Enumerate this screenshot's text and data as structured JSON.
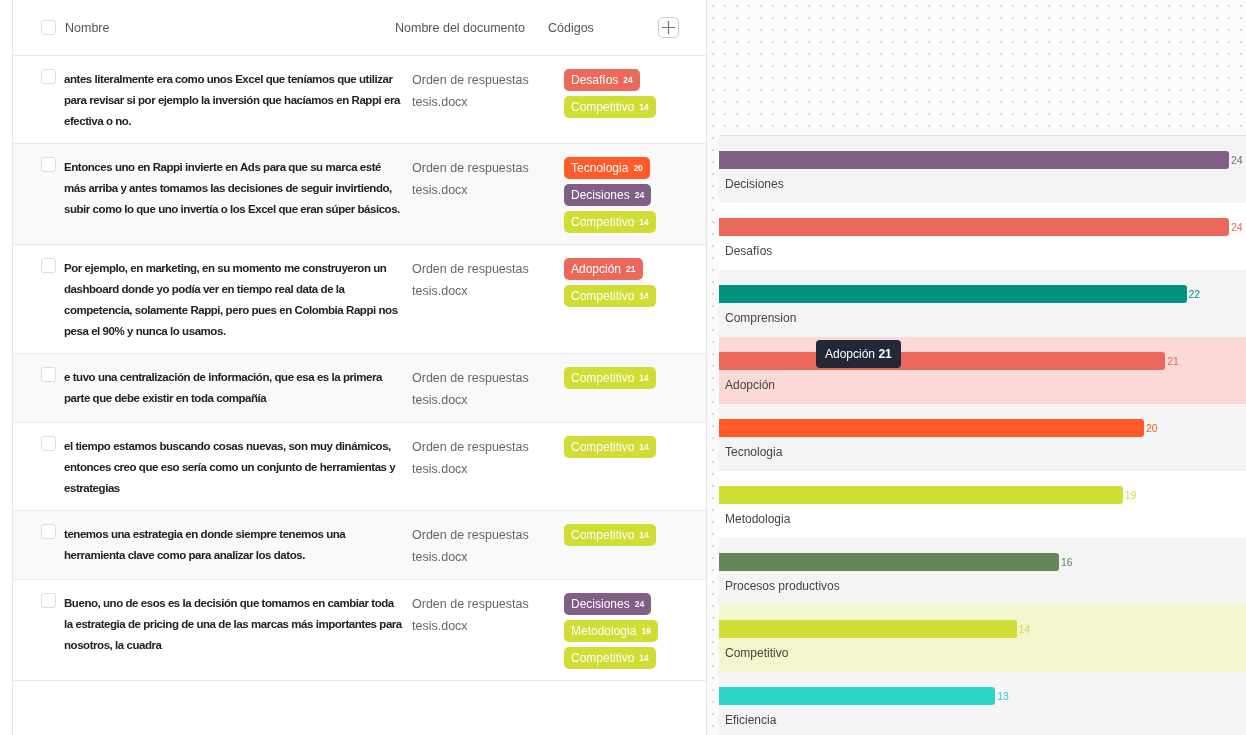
{
  "table": {
    "header": {
      "checked": false,
      "columns": [
        "Nombre",
        "Nombre del documento",
        "Códigos"
      ]
    },
    "rows": [
      {
        "checked": false,
        "text": "antes literalmente era como unos Excel que teníamos que utilizar para revisar si por ejemplo la inversión que hacíamos en Rappi era efectiva o no.",
        "document": "Orden de respuestas tesis.docx",
        "codes": [
          {
            "label": "Desafíos",
            "count": "24",
            "color": "#ea695b"
          },
          {
            "label": "Competitivo",
            "count": "14",
            "color": "#cfdd35"
          }
        ]
      },
      {
        "checked": false,
        "text": "Entonces uno en Rappi invierte en Ads para que su marca esté más arriba y antes tomamos las decisiones de seguir invirtiendo, subir como lo que uno invertía o los Excel que eran súper básicos.",
        "document": "Orden de respuestas tesis.docx",
        "codes": [
          {
            "label": "Tecnologia",
            "count": "20",
            "color": "#ff5a27"
          },
          {
            "label": "Decisiones",
            "count": "24",
            "color": "#815e86"
          },
          {
            "label": "Competitivo",
            "count": "14",
            "color": "#cfdd35"
          }
        ]
      },
      {
        "checked": false,
        "text": "Por ejemplo, en marketing, en su momento me construyeron un dashboard donde yo podía ver en tiempo real data de la competencia, solamente Rappi, pero pues en Colombia Rappi nos pesa el 90% y nunca lo usamos.",
        "document": "Orden de respuestas tesis.docx",
        "codes": [
          {
            "label": "Adopción",
            "count": "21",
            "color": "#ea695b"
          },
          {
            "label": "Competitivo",
            "count": "14",
            "color": "#cfdd35"
          }
        ]
      },
      {
        "checked": false,
        "text": "e tuvo una centralización de información, que esa es la primera parte que debe existir en toda compañía",
        "document": "Orden de respuestas tesis.docx",
        "codes": [
          {
            "label": "Competitivo",
            "count": "14",
            "color": "#cfdd35"
          }
        ]
      },
      {
        "checked": false,
        "text": "el tiempo estamos buscando cosas nuevas, son muy dinámicos, entonces creo que eso sería como un conjunto de herramientas y estrategias",
        "document": "Orden de respuestas tesis.docx",
        "codes": [
          {
            "label": "Competitivo",
            "count": "14",
            "color": "#cfdd35"
          }
        ]
      },
      {
        "checked": false,
        "text": "tenemos una estrategia en donde siempre tenemos una herramienta clave como para analizar los datos.",
        "document": "Orden de respuestas tesis.docx",
        "codes": [
          {
            "label": "Competitivo",
            "count": "14",
            "color": "#cfdd35"
          }
        ]
      },
      {
        "checked": false,
        "text": "Bueno, uno de esos es la decisión que tomamos en cambiar toda la estrategia de pricing de una de las marcas más importantes para nosotros, la cuadra",
        "document": "Orden de respuestas tesis.docx",
        "codes": [
          {
            "label": "Decisiones",
            "count": "24",
            "color": "#815e86"
          },
          {
            "label": "Metodologia",
            "count": "19",
            "color": "#cfdd35"
          },
          {
            "label": "Competitivo",
            "count": "14",
            "color": "#cfdd35"
          }
        ]
      }
    ]
  },
  "chart": {
    "chart_data": {
      "type": "bar",
      "orientation": "horizontal",
      "data_labels": true,
      "categories": [
        "Decisiones",
        "Desafíos",
        "Comprension",
        "Adopción",
        "Tecnologia",
        "Metodologia",
        "Procesos productivos",
        "Competitivo",
        "Eficiencia"
      ],
      "values": [
        24,
        24,
        22,
        21,
        20,
        19,
        16,
        14,
        13
      ],
      "colors": [
        "#815e86",
        "#ea695b",
        "#00947f",
        "#ea695b",
        "#ff5a27",
        "#cfdd35",
        "#66865c",
        "#cfdd35",
        "#2ad4c6"
      ]
    },
    "row_states": [
      {
        "highlighted": false
      },
      {
        "highlighted": false
      },
      {
        "highlighted": false
      },
      {
        "highlighted": true
      },
      {
        "highlighted": false
      },
      {
        "highlighted": false
      },
      {
        "highlighted": false
      },
      {
        "highlighted": true
      },
      {
        "highlighted": false
      }
    ],
    "tooltip": {
      "label": "Adopción",
      "value": "21"
    }
  }
}
